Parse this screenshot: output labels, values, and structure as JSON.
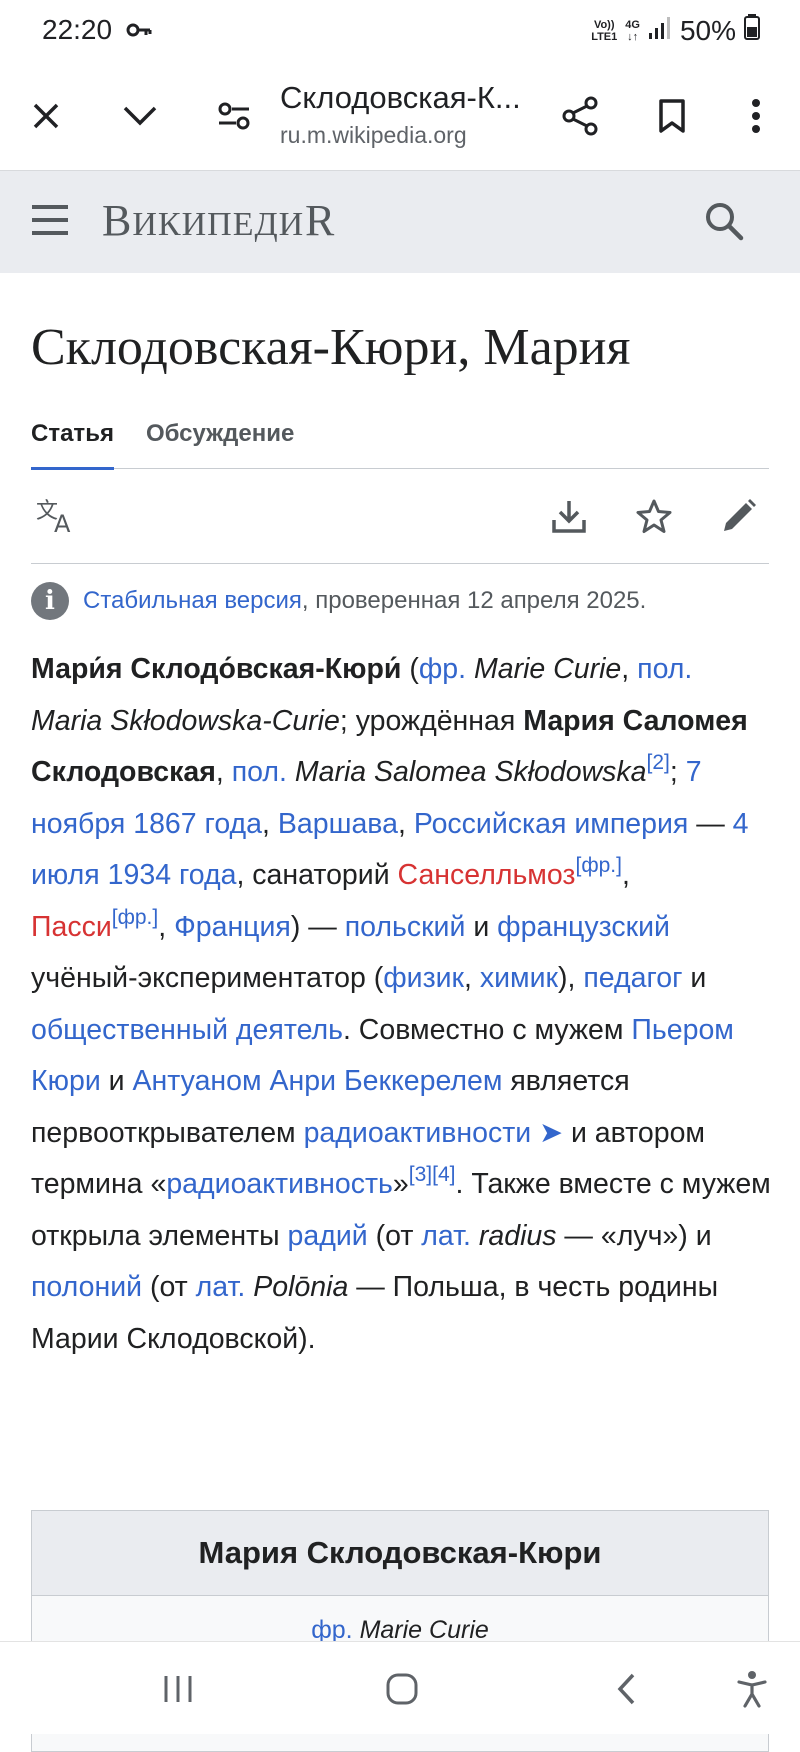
{
  "status": {
    "time": "22:20",
    "net_top": "Vo))",
    "net_bottom": "LTE1",
    "net_type": "4G",
    "battery": "50%"
  },
  "browser": {
    "title": "Склодовская-К...",
    "domain": "ru.m.wikipedia.org"
  },
  "wiki": {
    "logo_first": "В",
    "logo_middle": "икипеди",
    "logo_last": "я"
  },
  "page": {
    "title": "Склодовская-Кюри, Мария",
    "tabs": [
      "Статья",
      "Обсуждение"
    ],
    "stable_link": "Стабильная версия",
    "stable_rest": ", проверенная 12 апреля 2025."
  },
  "article": {
    "t1": "Мари́я Склодо́вская-Кюри́",
    "t2": " (",
    "t3": "фр.",
    "t4": " ",
    "t5": "Marie Curie",
    "t6": ", ",
    "t7": "пол.",
    "t8": " ",
    "t9": "Maria Skłodowska-Curie",
    "t10": "; урождённая ",
    "t11": "Мария Саломея Склодовская",
    "t12": ", ",
    "t13": "пол.",
    "t14": " ",
    "t15": "Maria Salomea Skłodowska",
    "t16": "[2]",
    "t17": "; ",
    "t18": "7 ноября 1867 года",
    "t19": ", ",
    "t20": "Варшава",
    "t21": ", ",
    "t22": "Российская империя",
    "t23": " — ",
    "t24": "4 июля 1934 года",
    "t25": ", санаторий ",
    "t26": "Санселльмоз",
    "t27": "[фр.]",
    "t28": ", ",
    "t29": "Пасси",
    "t30": "[фр.]",
    "t31": ", ",
    "t32": "Франция",
    "t33": ") — ",
    "t34": "польский",
    "t35": " и ",
    "t36": "французский",
    "t37": " учёный-экспериментатор (",
    "t38": "физик",
    "t39": ", ",
    "t40": "химик",
    "t41": "), ",
    "t42": "педагог",
    "t43": " и ",
    "t44": "общественный деятель",
    "t45": ". Совместно с мужем ",
    "t46": "Пьером Кюри",
    "t47": " и ",
    "t48": "Антуаном Анри Беккерелем",
    "t49": " является первооткрывателем ",
    "t50": "радиоактивности ➤",
    "t51": " и автором термина «",
    "t52": "радиоактивность",
    "t53": "»",
    "t54": "[3][4]",
    "t55": ". Также вместе с мужем открыла элементы ",
    "t56": "радий",
    "t57": " (от ",
    "t58": "лат.",
    "t59": " ",
    "t60": "radius",
    "t61": " — «луч») и ",
    "t62": "полоний",
    "t63": " (от ",
    "t64": "лат.",
    "t65": " ",
    "t66": "Polōnia",
    "t67": " — Польша, в честь родины Марии Склодовской)."
  },
  "infobox": {
    "title": "Мария Склодовская-Кюри",
    "lang": "фр.",
    "name": "Marie Curie"
  },
  "colors": {
    "link": "#3366cc",
    "redlink": "#d73333",
    "header_bg": "#eaecf0",
    "text": "#202122"
  },
  "icons": [
    "key-icon",
    "signal-icon",
    "battery-icon",
    "close-icon",
    "chevron-down-icon",
    "site-settings-icon",
    "share-icon",
    "bookmark-icon",
    "more-vert-icon",
    "menu-icon",
    "search-icon",
    "language-icon",
    "download-icon",
    "star-icon",
    "edit-icon",
    "info-icon",
    "recents-icon",
    "home-icon",
    "back-icon",
    "accessibility-icon"
  ]
}
